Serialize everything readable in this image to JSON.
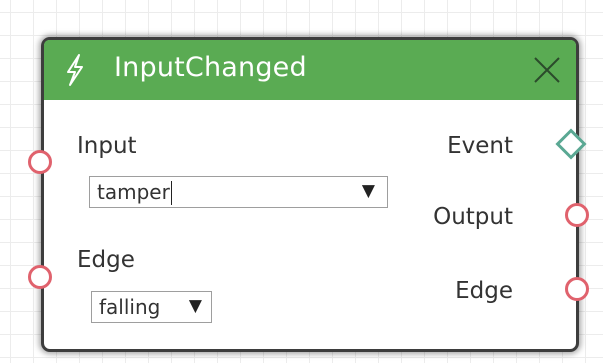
{
  "node": {
    "title": "InputChanged",
    "title_icon": "bolt-icon",
    "close_icon": "close-icon",
    "header_color": "#5aab53"
  },
  "inputs": {
    "input": {
      "label": "Input",
      "value": "tamper"
    },
    "edge": {
      "label": "Edge",
      "value": "falling"
    }
  },
  "outputs": {
    "event": {
      "label": "Event"
    },
    "output": {
      "label": "Output"
    },
    "edge": {
      "label": "Edge"
    }
  },
  "colors": {
    "port_red": "#e0626d",
    "port_event": "#5aa893"
  }
}
